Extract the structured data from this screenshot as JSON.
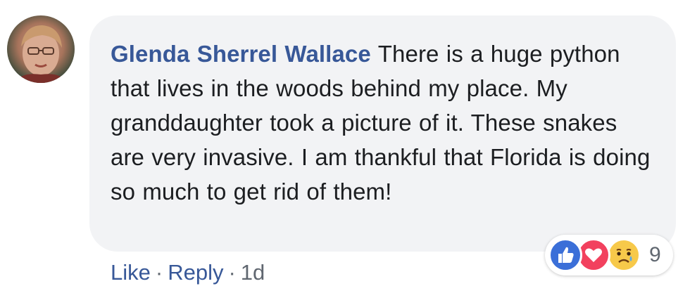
{
  "comment": {
    "author": "Glenda Sherrel Wallace",
    "text": "There is a huge python that lives in the woods behind my place. My granddaughter took a picture of it. These snakes are very invasive. I am thankful that Florida is doing so much to get rid of them!",
    "actions": {
      "like_label": "Like",
      "reply_label": "Reply",
      "separator": "·",
      "timestamp": "1d"
    },
    "reactions": {
      "icons": [
        "like-icon",
        "love-icon",
        "sad-icon"
      ],
      "count": "9"
    }
  },
  "colors": {
    "link_blue": "#385898",
    "bubble_bg": "#f2f3f5",
    "text": "#1c1e21",
    "meta_gray": "#606770",
    "like_blue": "#3b6fd8",
    "love_red": "#f2415e",
    "sad_yellow": "#f7c94a"
  }
}
